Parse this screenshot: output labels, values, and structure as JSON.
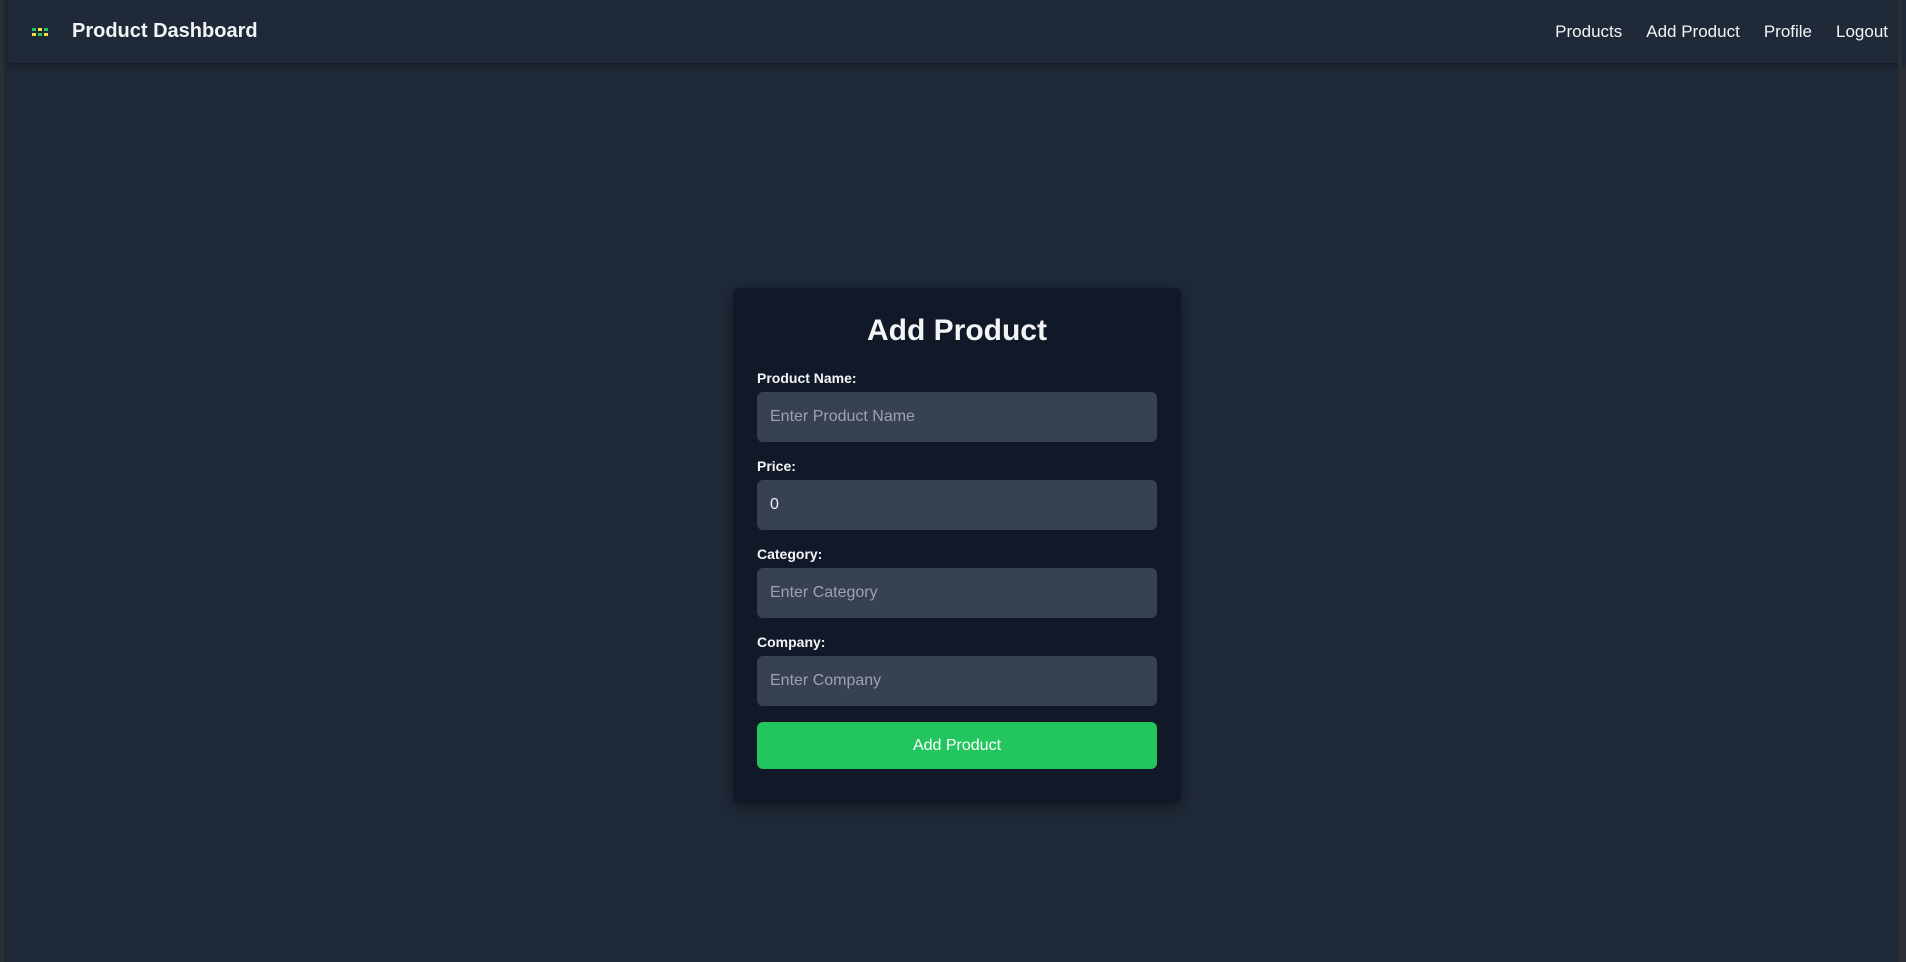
{
  "header": {
    "title": "Product Dashboard",
    "logo_icon": "grid-logo-icon"
  },
  "nav": {
    "items": [
      {
        "label": "Products"
      },
      {
        "label": "Add Product"
      },
      {
        "label": "Profile"
      },
      {
        "label": "Logout"
      }
    ]
  },
  "form": {
    "title": "Add Product",
    "fields": [
      {
        "label": "Product Name:",
        "placeholder": "Enter Product Name",
        "value": ""
      },
      {
        "label": "Price:",
        "placeholder": "",
        "value": "0"
      },
      {
        "label": "Category:",
        "placeholder": "Enter Category",
        "value": ""
      },
      {
        "label": "Company:",
        "placeholder": "Enter Company",
        "value": ""
      }
    ],
    "submit_label": "Add Product"
  },
  "colors": {
    "background": "#1f2937",
    "card": "#111827",
    "input": "#374151",
    "accent": "#22c55e"
  }
}
